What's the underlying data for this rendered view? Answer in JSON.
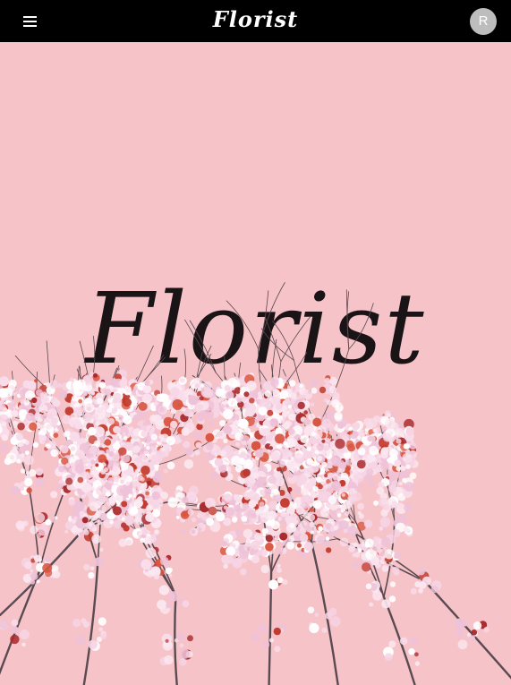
{
  "header": {
    "menu_icon": "menu-icon",
    "brand": "Florist",
    "avatar_initial": "R"
  },
  "hero": {
    "title": "Florist",
    "image": "cherry-blossom-branches",
    "colors": {
      "background": "#f6c3c8",
      "topbar": "#000000",
      "avatar": "#bdbdbd"
    }
  }
}
